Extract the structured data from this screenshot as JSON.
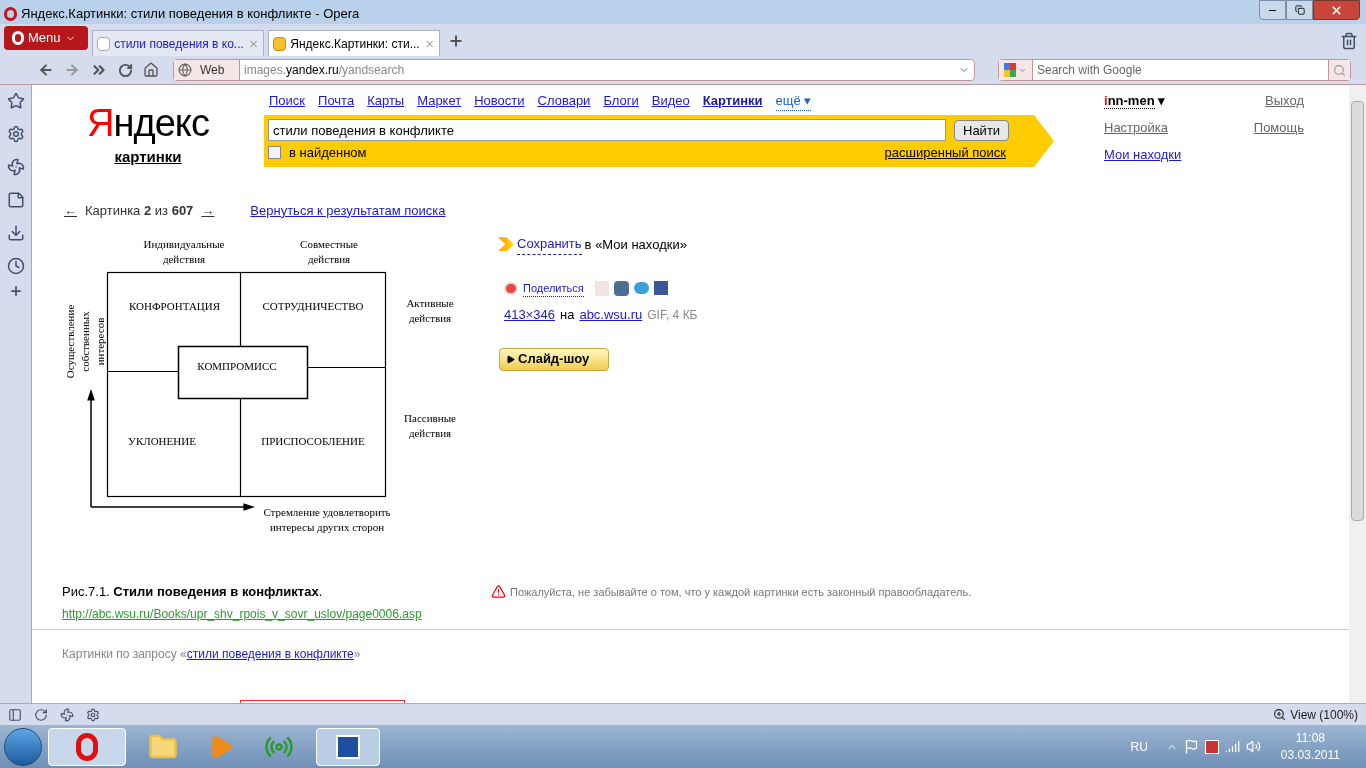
{
  "window": {
    "title": "Яндекс.Картинки: стили поведения в конфликте - Opera"
  },
  "browser": {
    "menu_label": "Menu",
    "tabs": [
      {
        "label": "стили поведения в ко...",
        "selected": false
      },
      {
        "label": "Яндекс.Картинки: сти...",
        "selected": true
      }
    ],
    "address": {
      "scheme_label": "Web",
      "host_prefix": "images.",
      "host": "yandex.ru",
      "path": "/yandsearch"
    },
    "search": {
      "placeholder": "Search with Google"
    },
    "status": {
      "zoom": "View (100%)"
    }
  },
  "header": {
    "logo": {
      "first": "Я",
      "rest": "ндекс"
    },
    "service": "картинки",
    "nav": [
      {
        "label": "Поиск",
        "selected": false
      },
      {
        "label": "Почта",
        "selected": false
      },
      {
        "label": "Карты",
        "selected": false
      },
      {
        "label": "Маркет",
        "selected": false
      },
      {
        "label": "Новости",
        "selected": false
      },
      {
        "label": "Словари",
        "selected": false
      },
      {
        "label": "Блоги",
        "selected": false
      },
      {
        "label": "Видео",
        "selected": false
      },
      {
        "label": "Картинки",
        "selected": true
      }
    ],
    "more": "ещё ▾",
    "query": "стили поведения в конфликте",
    "search_button": "Найти",
    "in_found": {
      "label": "в найденном",
      "checked": false
    },
    "advanced": "расширенный поиск",
    "user": {
      "first": "i",
      "rest": "nn-men",
      "caret": "▾"
    },
    "user_links": [
      "Выход",
      "Настройка",
      "Помощь",
      "Мои находки"
    ]
  },
  "pager": {
    "prev": "←",
    "text": "Картинка **2** из **607**",
    "next": "→",
    "back": "Вернуться к результатам поиска"
  },
  "diagram": {
    "top_left": "Индивидуальные действия",
    "top_right": "Совместные действия",
    "y_axis": "Осуществление собственных интересов",
    "cells": [
      "КОНФРОНТАЦИЯ",
      "СОТРУДНИЧЕСТВО",
      "УКЛОНЕНИЕ",
      "ПРИСПОСОБЛЕНИЕ"
    ],
    "center": "КОМПРОМИСС",
    "right_top": "Активные действия",
    "right_bottom": "Пассивные действия",
    "x_axis": "Стремление удовлетворить интересы других сторон"
  },
  "actions": {
    "save": "Сохранить",
    "save_rest": "в «Мои находки»",
    "share": "Поделиться",
    "size": "413×346",
    "on": "на",
    "site": "abc.wsu.ru",
    "format": "GIF, 4 КБ",
    "slideshow": "Слайд-шоу"
  },
  "caption": {
    "text": "Рис.7.1. **Стили поведения в конфликтах**.",
    "url": "http://abc.wsu.ru/Books/upr_shv_rpois_v_sovr_uslov/page0006.asp"
  },
  "notice": "Пожалуйста, не забывайте о том, что у каждой картинки есть законный правообладатель.",
  "footer": {
    "prefix": "Картинки по запросу «",
    "query": "стили поведения в конфликте",
    "suffix": "»"
  },
  "taskbar": {
    "lang": "RU",
    "time": "11:08",
    "date": "03.03.2011"
  }
}
